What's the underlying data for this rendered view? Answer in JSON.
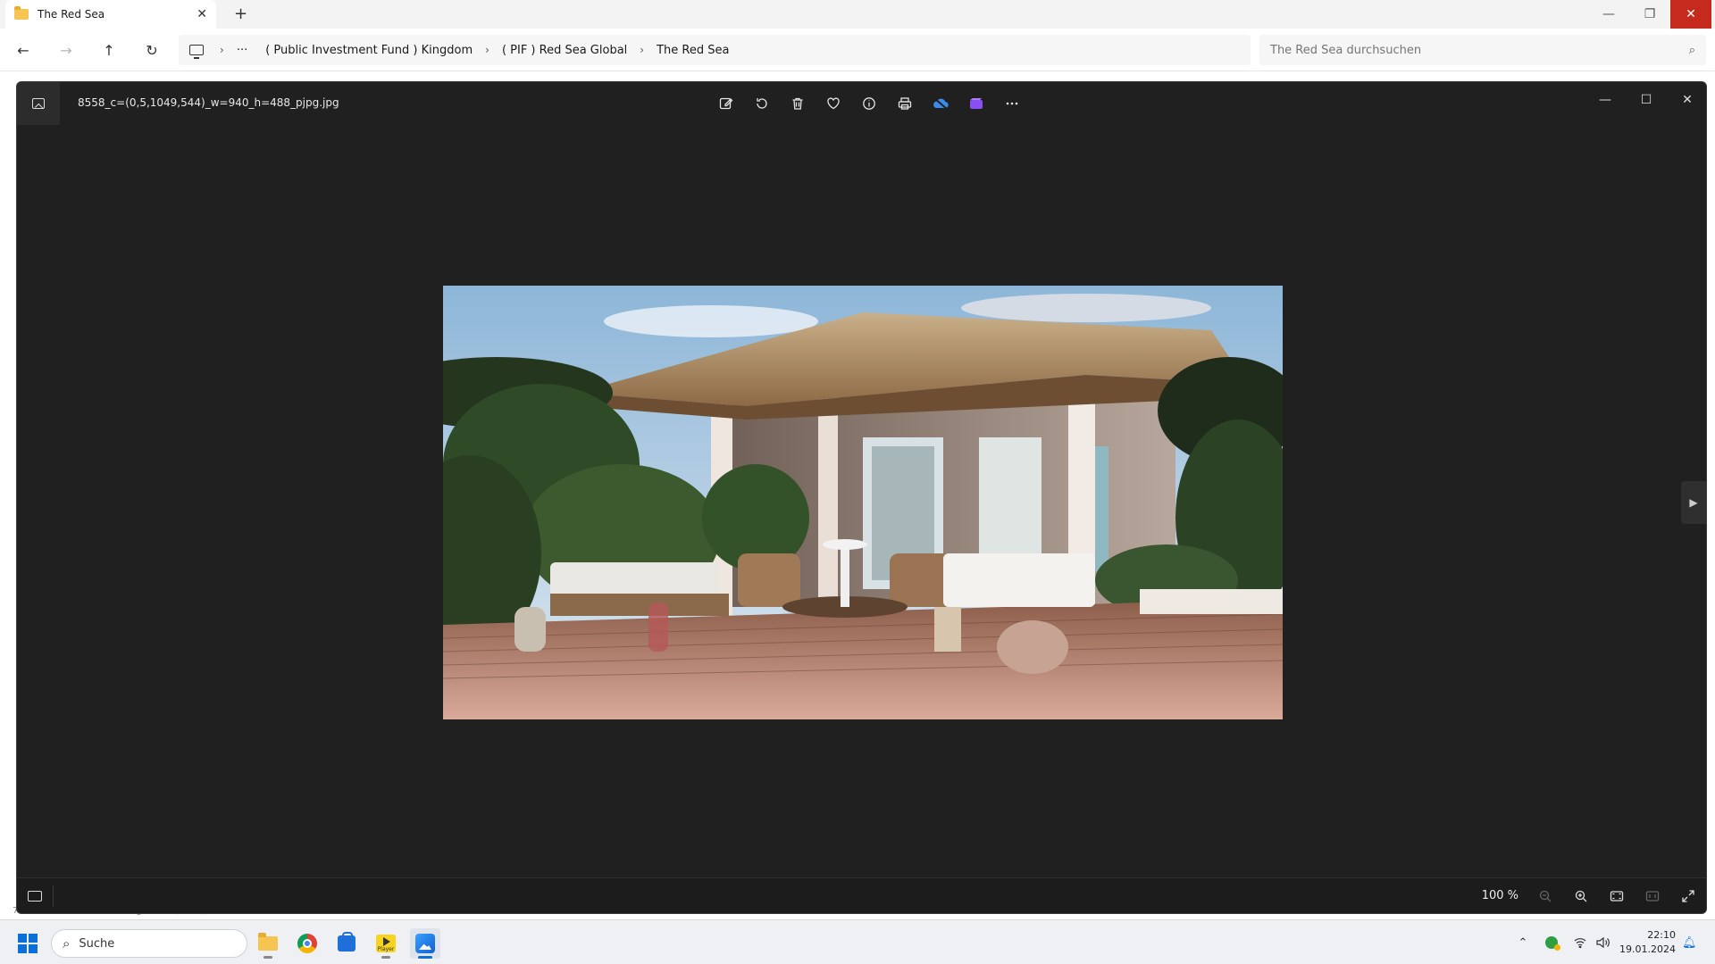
{
  "explorer": {
    "tab_title": "The Red Sea",
    "breadcrumb": [
      "( Public Investment Fund ) Kingdom",
      "( PIF ) Red Sea Global",
      "The Red Sea"
    ],
    "search_placeholder": "The Red Sea durchsuchen",
    "status_text": "7 Elemente · 1 Element ausgewählt (47 KB)"
  },
  "viewer": {
    "filename": "8558_c=(0,5,1049,544)_w=940_h=488_pjpg.jpg",
    "zoom": "100 %",
    "toolbar_icons": [
      "edit-icon",
      "rotate-icon",
      "delete-icon",
      "favorite-icon",
      "info-icon",
      "print-icon",
      "onedrive-icon",
      "clipchamp-icon",
      "more-icon"
    ]
  },
  "taskbar": {
    "search_label": "Suche",
    "time": "22:10",
    "date": "19.01.2024",
    "player_label": "Player"
  },
  "colors": {
    "viewer_bg": "#202020",
    "accent": "#0b6fd6",
    "close_red": "#c42b1c"
  }
}
